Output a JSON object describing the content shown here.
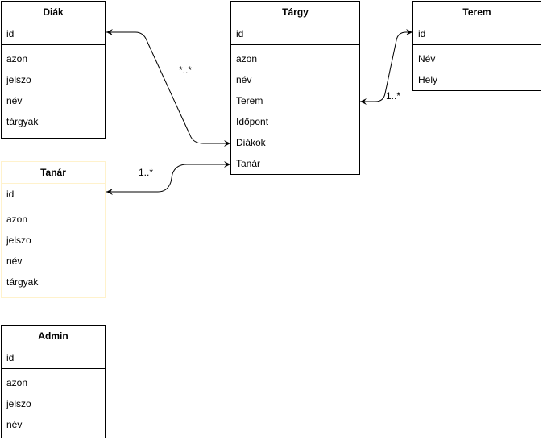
{
  "entities": {
    "diak": {
      "title": "Diák",
      "key": "id",
      "fields": [
        "azon",
        "jelszo",
        "név",
        "tárgyak"
      ]
    },
    "tanar": {
      "title": "Tanár",
      "key": "id",
      "fields": [
        "azon",
        "jelszo",
        "név",
        "tárgyak"
      ]
    },
    "admin": {
      "title": "Admin",
      "key": "id",
      "fields": [
        "azon",
        "jelszo",
        "név"
      ]
    },
    "targy": {
      "title": "Tárgy",
      "key": "id",
      "fields": [
        "azon",
        "név",
        "Terem",
        "Időpont",
        "Diákok",
        "Tanár"
      ]
    },
    "terem": {
      "title": "Terem",
      "key": "id",
      "fields": [
        "Név",
        "Hely"
      ]
    }
  },
  "relations": {
    "diak_targy": "*..*",
    "tanar_targy": "1..*",
    "terem_targy": "1..*"
  }
}
